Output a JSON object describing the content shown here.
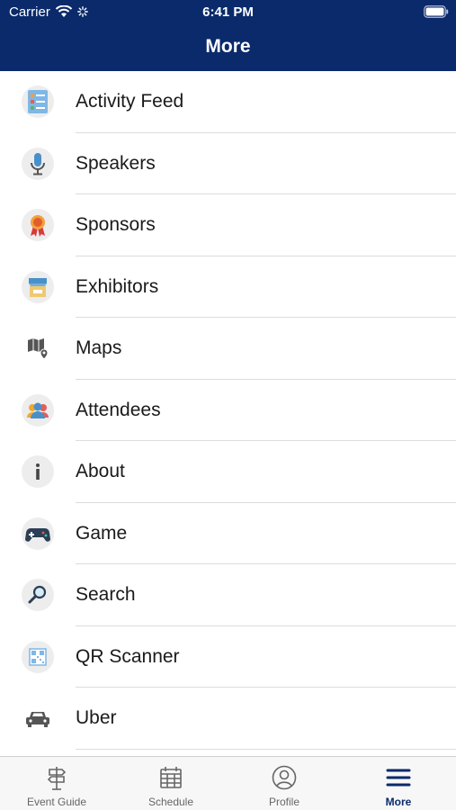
{
  "status_bar": {
    "carrier": "Carrier",
    "time": "6:41 PM"
  },
  "header": {
    "title": "More"
  },
  "menu": [
    {
      "label": "Activity Feed",
      "icon": "activity-feed-icon"
    },
    {
      "label": "Speakers",
      "icon": "microphone-icon"
    },
    {
      "label": "Sponsors",
      "icon": "award-ribbon-icon"
    },
    {
      "label": "Exhibitors",
      "icon": "booth-icon"
    },
    {
      "label": "Maps",
      "icon": "map-icon"
    },
    {
      "label": "Attendees",
      "icon": "people-icon"
    },
    {
      "label": "About",
      "icon": "info-icon"
    },
    {
      "label": "Game",
      "icon": "gamepad-icon"
    },
    {
      "label": "Search",
      "icon": "magnifier-icon"
    },
    {
      "label": "QR Scanner",
      "icon": "qr-code-icon"
    },
    {
      "label": "Uber",
      "icon": "car-icon"
    }
  ],
  "tabs": [
    {
      "label": "Event Guide",
      "icon": "signpost-icon",
      "active": false
    },
    {
      "label": "Schedule",
      "icon": "calendar-icon",
      "active": false
    },
    {
      "label": "Profile",
      "icon": "user-circle-icon",
      "active": false
    },
    {
      "label": "More",
      "icon": "hamburger-icon",
      "active": true
    }
  ],
  "colors": {
    "header": "#0a2a6b",
    "active_tab": "#0a2a6b",
    "divider": "#dcdcdc"
  }
}
